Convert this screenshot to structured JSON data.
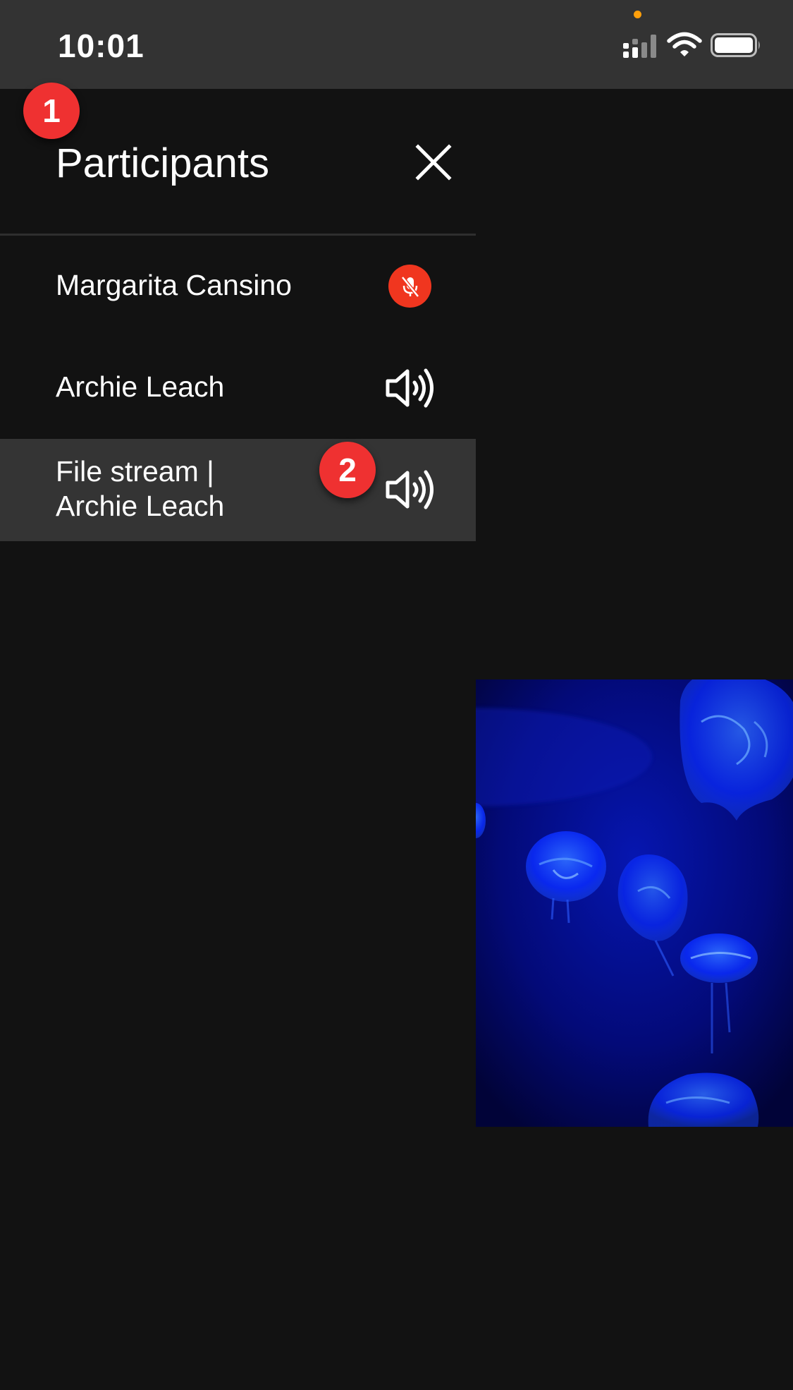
{
  "status_bar": {
    "time": "10:01",
    "recording_indicator_color": "#ff9f0a",
    "icons": [
      "cellular-signal-icon",
      "wifi-icon",
      "battery-icon"
    ]
  },
  "panel": {
    "title": "Participants",
    "close_icon": "close-icon"
  },
  "participants": [
    {
      "name": "Margarita Cansino",
      "audio_icon": "microphone-muted-icon",
      "audio_state": "muted",
      "highlighted": false
    },
    {
      "name": "Archie Leach",
      "audio_icon": "speaker-icon",
      "audio_state": "unmuted",
      "highlighted": false
    },
    {
      "name": "File stream |\nArchie Leach",
      "audio_icon": "speaker-icon",
      "audio_state": "unmuted",
      "highlighted": true
    }
  ],
  "video_tile": {
    "content": "jellyfish video stream"
  },
  "annotations": [
    {
      "label": "1"
    },
    {
      "label": "2"
    }
  ],
  "colors": {
    "background": "#121212",
    "status_bar": "#333333",
    "highlight_row": "#343434",
    "muted_badge": "#f0361f",
    "annotation_badge": "#ef3131",
    "video_blue": "#0a2cff"
  }
}
